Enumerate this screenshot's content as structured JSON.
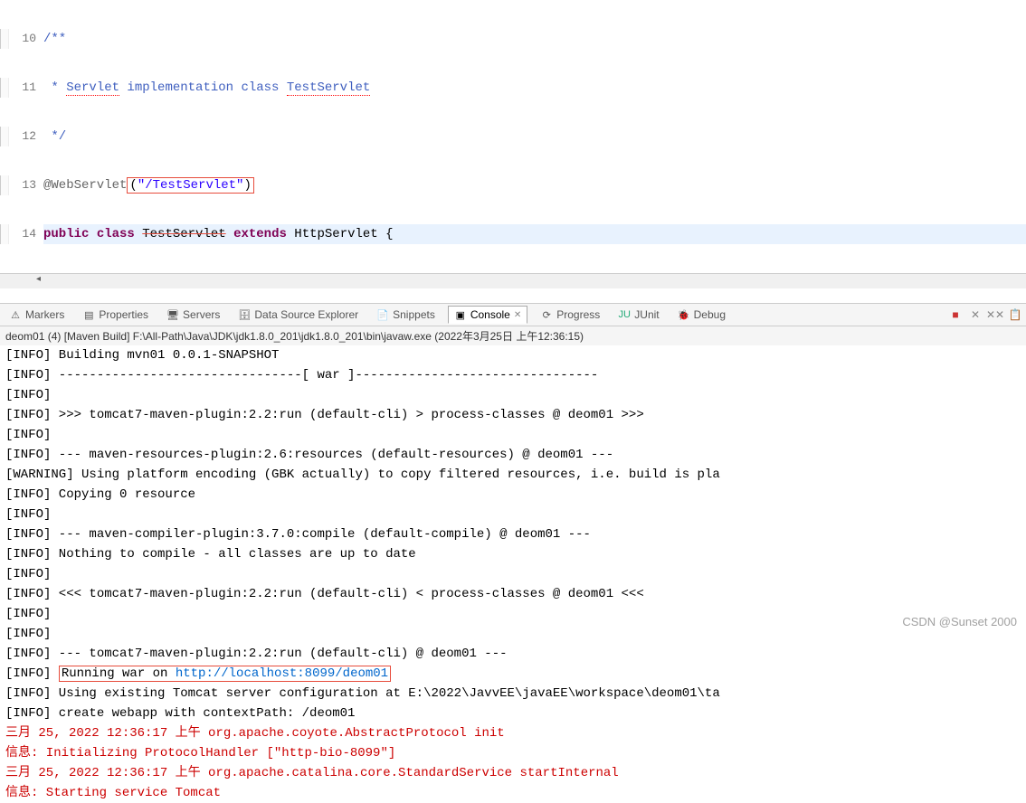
{
  "editor": {
    "lines": [
      {
        "num": "10",
        "prefix": "",
        "content": "/**"
      },
      {
        "num": "11",
        "prefix": " * ",
        "word1": "Servlet",
        "mid": " implementation class ",
        "word2": "TestServlet"
      },
      {
        "num": "12",
        "prefix": " ",
        "content": "*/"
      },
      {
        "num": "13",
        "ann": "@WebServlet",
        "paren_open": "(",
        "str": "\"/TestServlet\"",
        "paren_close": ")"
      },
      {
        "num": "14",
        "kw1": "public",
        "kw2": "class",
        "cls": "TestServlet",
        "kw3": "extends",
        "sup": "HttpServlet {"
      }
    ]
  },
  "tabs": {
    "markers": "Markers",
    "properties": "Properties",
    "servers": "Servers",
    "data_source": "Data Source Explorer",
    "snippets": "Snippets",
    "console": "Console",
    "console_x": "✕",
    "progress": "Progress",
    "junit": "JUnit",
    "debug": "Debug"
  },
  "console_header": "deom01 (4) [Maven Build] F:\\All-Path\\Java\\JDK\\jdk1.8.0_201\\jdk1.8.0_201\\bin\\javaw.exe (2022年3月25日 上午12:36:15)",
  "console_lines": [
    {
      "t": "[INFO] Building mvn01 0.0.1-SNAPSHOT",
      "cls": ""
    },
    {
      "t": "[INFO] --------------------------------[ war ]--------------------------------",
      "cls": ""
    },
    {
      "t": "[INFO]",
      "cls": ""
    },
    {
      "t": "[INFO] >>> tomcat7-maven-plugin:2.2:run (default-cli) > process-classes @ deom01 >>>",
      "cls": ""
    },
    {
      "t": "[INFO]",
      "cls": ""
    },
    {
      "t": "[INFO] --- maven-resources-plugin:2.6:resources (default-resources) @ deom01 ---",
      "cls": ""
    },
    {
      "t": "[WARNING] Using platform encoding (GBK actually) to copy filtered resources, i.e. build is pla",
      "cls": ""
    },
    {
      "t": "[INFO] Copying 0 resource",
      "cls": ""
    },
    {
      "t": "[INFO]",
      "cls": ""
    },
    {
      "t": "[INFO] --- maven-compiler-plugin:3.7.0:compile (default-compile) @ deom01 ---",
      "cls": ""
    },
    {
      "t": "[INFO] Nothing to compile - all classes are up to date",
      "cls": ""
    },
    {
      "t": "[INFO]",
      "cls": ""
    },
    {
      "t": "[INFO] <<< tomcat7-maven-plugin:2.2:run (default-cli) < process-classes @ deom01 <<<",
      "cls": ""
    },
    {
      "t": "[INFO]",
      "cls": ""
    },
    {
      "t": "[INFO]",
      "cls": ""
    },
    {
      "t": "[INFO] --- tomcat7-maven-plugin:2.2:run (default-cli) @ deom01 ---",
      "cls": ""
    },
    {
      "prefix": "[INFO] ",
      "boxed": "Running war on ",
      "link": "http://localhost:8099/deom01",
      "cls": "boxed-line"
    },
    {
      "t": "[INFO] Using existing Tomcat server configuration at E:\\2022\\JavvEE\\javaEE\\workspace\\deom01\\ta",
      "cls": ""
    },
    {
      "t": "[INFO] create webapp with contextPath: /deom01",
      "cls": ""
    },
    {
      "t": "三月 25, 2022 12:36:17 上午 org.apache.coyote.AbstractProtocol init",
      "cls": "red-text"
    },
    {
      "t": "信息: Initializing ProtocolHandler [\"http-bio-8099\"]",
      "cls": "red-text"
    },
    {
      "t": "三月 25, 2022 12:36:17 上午 org.apache.catalina.core.StandardService startInternal",
      "cls": "red-text"
    },
    {
      "t": "信息: Starting service Tomcat",
      "cls": "red-text"
    }
  ],
  "watermark": "CSDN @Sunset 2000"
}
